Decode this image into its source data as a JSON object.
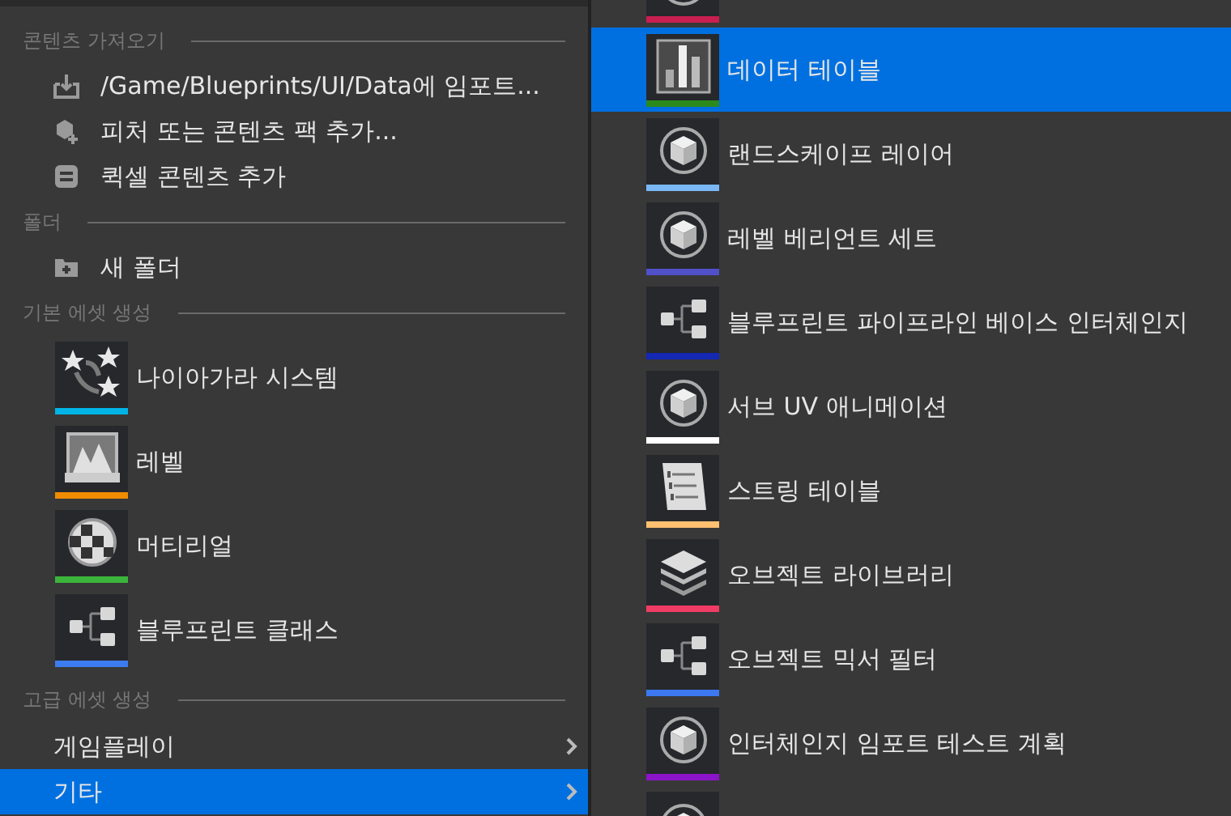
{
  "left_menu": {
    "sections": [
      {
        "header": "콘텐츠 가져오기",
        "items": [
          {
            "kind": "import",
            "label": "/Game/Blueprints/UI/Data에 임포트..."
          },
          {
            "kind": "pack",
            "label": "피처 또는 콘텐츠 팩 추가..."
          },
          {
            "kind": "quixel",
            "label": "퀵셀 콘텐츠 추가"
          }
        ]
      },
      {
        "header": "폴더",
        "items": [
          {
            "kind": "folder",
            "label": "새 폴더"
          }
        ]
      },
      {
        "header": "기본 에셋 생성",
        "items": [
          {
            "kind": "niagara",
            "label": "나이아가라 시스템",
            "color": "#00b4e6"
          },
          {
            "kind": "level",
            "label": "레벨",
            "color": "#f08c00"
          },
          {
            "kind": "material",
            "label": "머티리얼",
            "color": "#3cb43c"
          },
          {
            "kind": "blueprint",
            "label": "블루프린트 클래스",
            "color": "#3c7cf0"
          }
        ]
      },
      {
        "header": "고급 에셋 생성",
        "items": [
          {
            "kind": "submenu",
            "label": "게임플레이",
            "selected": false
          },
          {
            "kind": "submenu",
            "label": "기타",
            "selected": true
          }
        ]
      }
    ]
  },
  "submenu": {
    "items": [
      {
        "kind": "cube",
        "color": "#c81e50",
        "selected": false
      },
      {
        "kind": "datatable",
        "label": "데이터 테이블",
        "color": "#2a8a1c",
        "selected": true
      },
      {
        "kind": "cube",
        "label": "랜드스케이프 레이어",
        "color": "#7ab8f5",
        "selected": false
      },
      {
        "kind": "cube",
        "label": "레벨 베리언트 세트",
        "color": "#5050c8",
        "selected": false
      },
      {
        "kind": "blueprint",
        "label": "블루프린트 파이프라인 베이스 인터체인지",
        "color": "#1428b4",
        "selected": false
      },
      {
        "kind": "cube",
        "label": "서브 UV 애니메이션",
        "color": "#ffffff",
        "selected": false
      },
      {
        "kind": "string",
        "label": "스트링 테이블",
        "color": "#ffc070",
        "selected": false
      },
      {
        "kind": "layers",
        "label": "오브젝트 라이브러리",
        "color": "#f03c64",
        "selected": false
      },
      {
        "kind": "blueprint",
        "label": "오브젝트 믹서 필터",
        "color": "#3c78f0",
        "selected": false
      },
      {
        "kind": "cube",
        "label": "인터체인지 임포트 테스트 계획",
        "color": "#8c14c8",
        "selected": false
      },
      {
        "kind": "cube",
        "selected": false
      }
    ]
  }
}
